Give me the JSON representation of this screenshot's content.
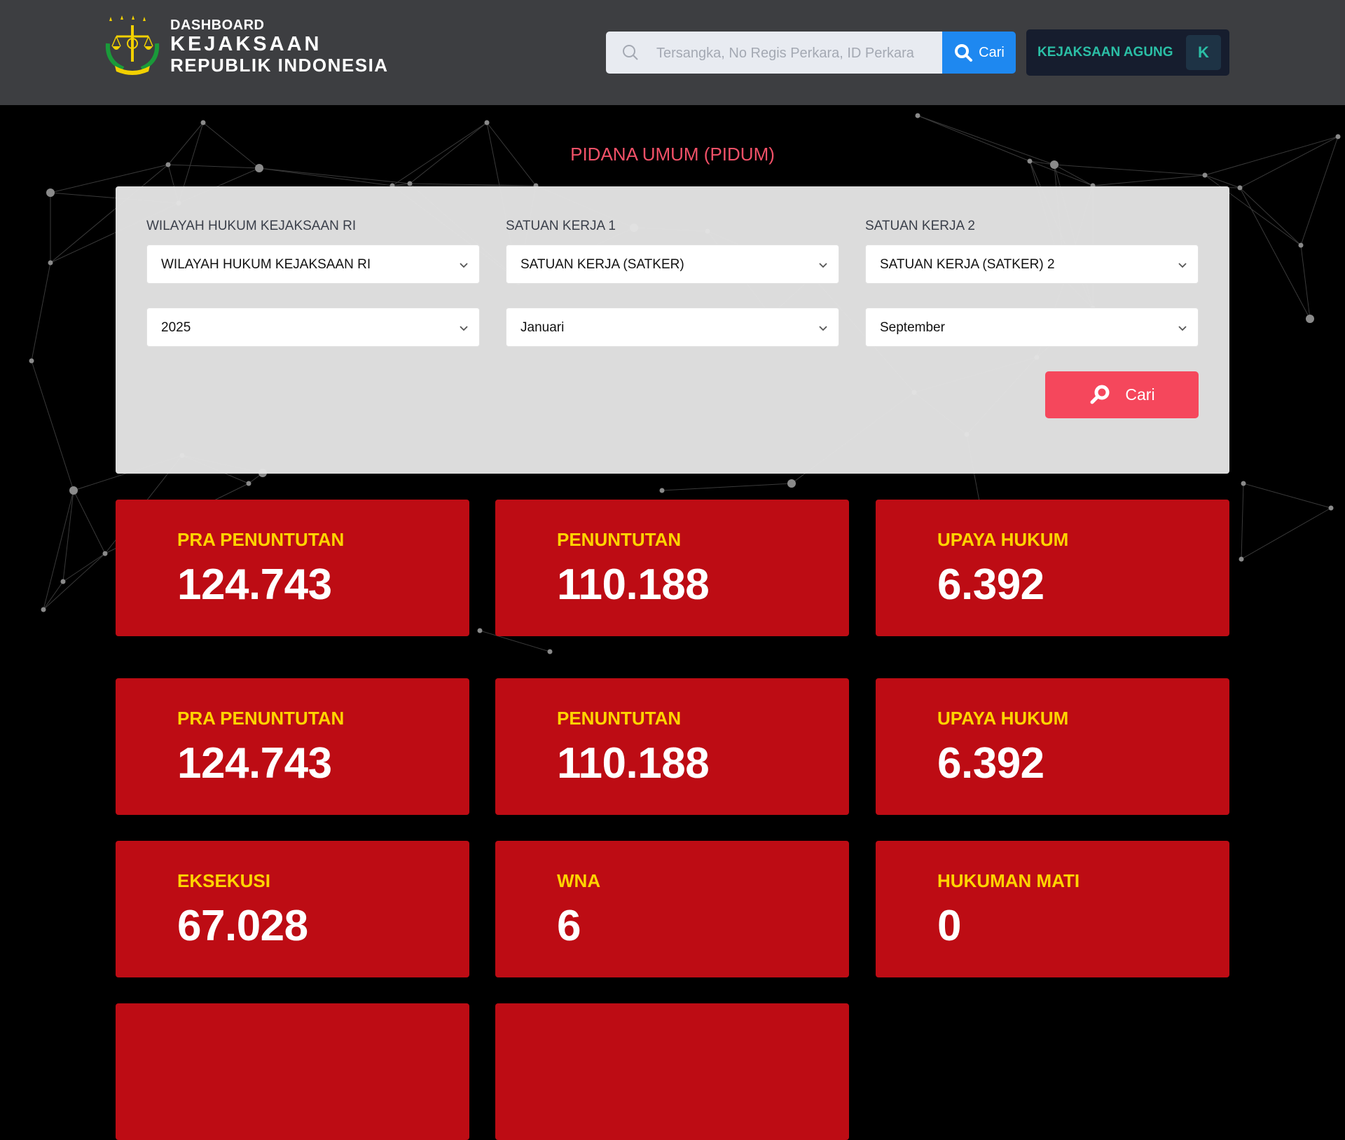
{
  "header": {
    "brand_line1": "DASHBOARD",
    "brand_line2": "KEJAKSAAN",
    "brand_line3": "REPUBLIK INDONESIA",
    "search_placeholder": "Tersangka, No Regis Perkara, ID Perkara",
    "search_button_label": "Cari",
    "user_name": "KEJAKSAAN AGUNG",
    "user_initial": "K"
  },
  "section_title": "PIDANA UMUM (PIDUM)",
  "filters": {
    "labels": [
      "WILAYAH HUKUM KEJAKSAAN RI",
      "SATUAN KERJA 1",
      "SATUAN KERJA 2"
    ],
    "row1": [
      "WILAYAH HUKUM KEJAKSAAN RI",
      "SATUAN KERJA (SATKER)",
      "SATUAN KERJA (SATKER) 2"
    ],
    "row2": [
      "2025",
      "Januari",
      "September"
    ],
    "search_button_label": "Cari"
  },
  "stats": {
    "group1": [
      {
        "label": "PRA PENUNTUTAN",
        "value": "124.743"
      },
      {
        "label": "PENUNTUTAN",
        "value": "110.188"
      },
      {
        "label": "UPAYA HUKUM",
        "value": "6.392"
      }
    ],
    "group2": [
      {
        "label": "PRA PENUNTUTAN",
        "value": "124.743"
      },
      {
        "label": "PENUNTUTAN",
        "value": "110.188"
      },
      {
        "label": "UPAYA HUKUM",
        "value": "6.392"
      },
      {
        "label": "EKSEKUSI",
        "value": "67.028"
      },
      {
        "label": "WNA",
        "value": "6"
      },
      {
        "label": "HUKUMAN MATI",
        "value": "0"
      }
    ]
  },
  "colors": {
    "header_bg": "#3d3e41",
    "card_bg": "#bd0c14",
    "card_label": "#ffd400",
    "accent_pink": "#f5475c",
    "search_blue": "#1e88f0",
    "user_teal": "#2bbfa6"
  }
}
